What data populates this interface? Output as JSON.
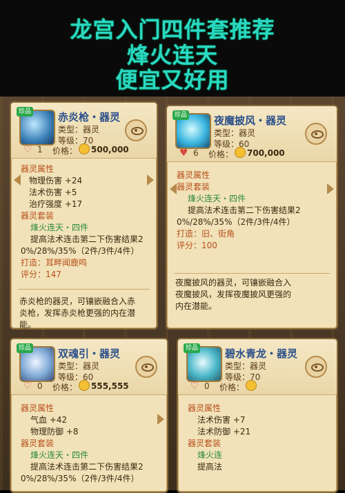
{
  "header": {
    "line1": "龙宫入门四件套推荐",
    "line2": "烽火连天",
    "line3": "便宜又好用"
  },
  "cards": [
    {
      "badge": "珍品",
      "name": "赤炎枪・器灵",
      "type": "类型：器灵",
      "level": "等级：70",
      "likes": "1",
      "price_label": "价格：",
      "price": "500,000",
      "attr_title": "器灵属性",
      "attrs": [
        "物理伤害 +24",
        "法术伤害 +5",
        "治疗强度 +17"
      ],
      "set_title": "器灵套装",
      "set_name": "烽火连天・四件",
      "set_effect_1": "提高法术连击第二下伤害结果2",
      "set_effect_2": "0%/28%/35%（2件/3件/4件）",
      "forge": "打造：耳畔闻鹿鸣",
      "score": "评分：147",
      "desc_1": "赤炎枪的器灵，可镶嵌融合入赤",
      "desc_2": "炎枪，发挥赤炎枪更强的内在潜能。"
    },
    {
      "badge": "珍品",
      "name": "夜魔披风・器灵",
      "type": "类型：器灵",
      "level": "等级：60",
      "likes": "6",
      "price_label": "价格：",
      "price": "700,000",
      "attr_title": "器灵属性",
      "set_title": "器灵套装",
      "set_name": "烽火连天・四件",
      "set_effect_1": "提高法术连击第二下伤害结果2",
      "set_effect_2": "0%/28%/35%（2件/3件/4件）",
      "forge": "打造：旧、街角",
      "score": "评分：100",
      "desc_1": "夜魔披风的器灵，可镶嵌融合入",
      "desc_2": "夜魔披风，发挥夜魔披风更强的",
      "desc_3": "内在潜能。"
    },
    {
      "badge": "珍品",
      "name": "双魂引・器灵",
      "type": "类型：器灵",
      "level": "等级：60",
      "likes": "0",
      "price_label": "价格：",
      "price": "555,555",
      "attr_title": "器灵属性",
      "attrs": [
        "气血 +42",
        "物理防御 +8"
      ],
      "set_title": "器灵套装",
      "set_name": "烽火连天・四件",
      "set_effect_1": "提高法术连击第二下伤害结果2",
      "set_effect_2": "0%/28%/35%（2件/3件/4件）"
    },
    {
      "badge": "珍品",
      "name": "碧水青龙・器灵",
      "type": "类型：器灵",
      "level": "等级：70",
      "likes": "0",
      "price_label": "价格：",
      "attr_title": "器灵属性",
      "attrs": [
        "法术伤害 +7",
        "法术防御 +21"
      ],
      "set_title": "器灵套装",
      "set_name": "烽火连",
      "set_effect_1": "提高法"
    }
  ]
}
